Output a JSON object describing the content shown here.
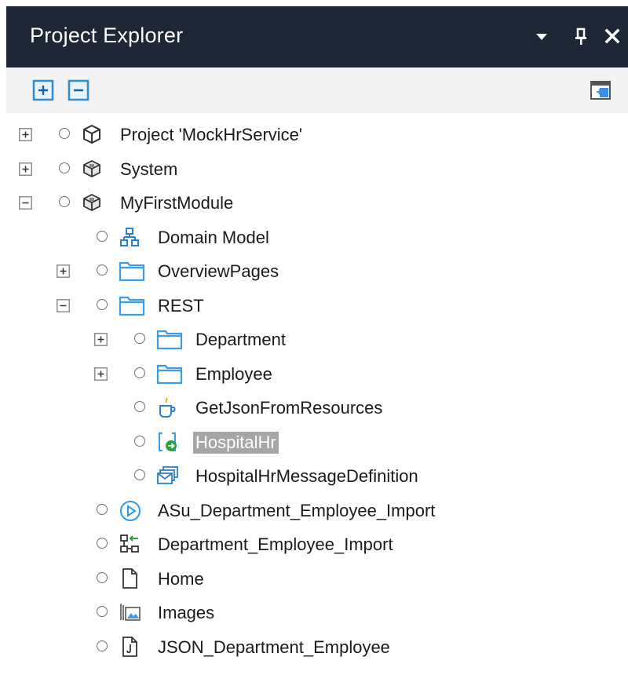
{
  "panel": {
    "title": "Project Explorer",
    "accent_color": "#1e2735",
    "buttons": [
      "dropdown-arrow-icon",
      "pin-icon",
      "close-icon"
    ]
  },
  "toolbar": {
    "buttons": [
      "expand-all-icon",
      "collapse-all-icon",
      "sync-editor-icon"
    ]
  },
  "tree": {
    "selected_color": "#a6a6a6",
    "items": [
      {
        "label": "Project 'MockHrService'",
        "depth": 0,
        "expander": "plus",
        "icon": "project-cube-icon"
      },
      {
        "label": "System",
        "depth": 0,
        "expander": "plus",
        "icon": "module-icon"
      },
      {
        "label": "MyFirstModule",
        "depth": 0,
        "expander": "minus",
        "icon": "module-icon"
      },
      {
        "label": "Domain Model",
        "depth": 1,
        "expander": "none",
        "icon": "domain-model-icon"
      },
      {
        "label": "OverviewPages",
        "depth": 1,
        "expander": "plus",
        "icon": "folder-icon"
      },
      {
        "label": "REST",
        "depth": 1,
        "expander": "minus",
        "icon": "folder-icon"
      },
      {
        "label": "Department",
        "depth": 2,
        "expander": "plus",
        "icon": "folder-icon"
      },
      {
        "label": "Employee",
        "depth": 2,
        "expander": "plus",
        "icon": "folder-icon"
      },
      {
        "label": "GetJsonFromResources",
        "depth": 2,
        "expander": "none",
        "icon": "java-action-icon"
      },
      {
        "label": "HospitalHr",
        "depth": 2,
        "expander": "none",
        "icon": "published-service-icon",
        "selected": true
      },
      {
        "label": "HospitalHrMessageDefinition",
        "depth": 2,
        "expander": "none",
        "icon": "message-definition-icon"
      },
      {
        "label": "ASu_Department_Employee_Import",
        "depth": 1,
        "expander": "none",
        "icon": "after-startup-icon"
      },
      {
        "label": "Department_Employee_Import",
        "depth": 1,
        "expander": "none",
        "icon": "import-mapping-icon"
      },
      {
        "label": "Home",
        "depth": 1,
        "expander": "none",
        "icon": "page-icon"
      },
      {
        "label": "Images",
        "depth": 1,
        "expander": "none",
        "icon": "images-icon"
      },
      {
        "label": "JSON_Department_Employee",
        "depth": 1,
        "expander": "none",
        "icon": "json-structure-icon"
      }
    ]
  }
}
